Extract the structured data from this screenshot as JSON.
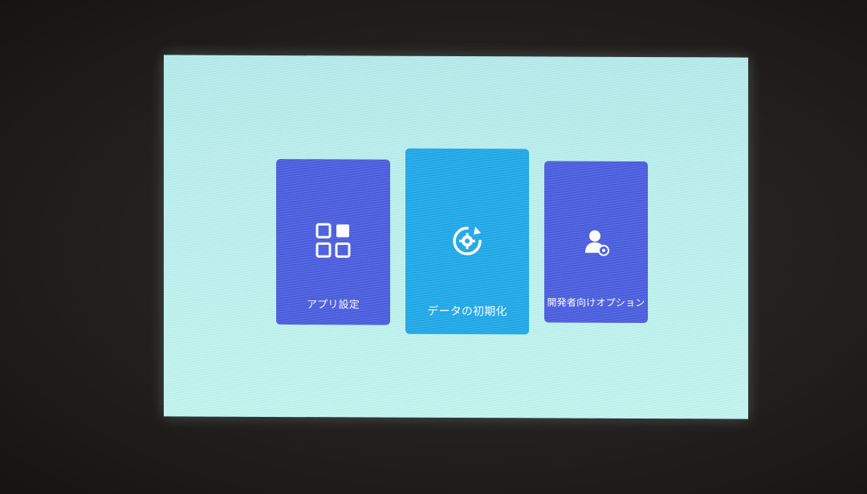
{
  "menu": {
    "items": [
      {
        "label": "アプリ設定",
        "icon": "apps-grid-icon"
      },
      {
        "label": "データの初期化",
        "icon": "factory-reset-icon"
      },
      {
        "label": "開発者向けオプション",
        "icon": "developer-user-icon"
      }
    ],
    "selected_index": 1
  },
  "colors": {
    "screen_background": "#bdf1ef",
    "card_default": "#4a5de0",
    "card_selected": "#1fa9ea",
    "text": "#ffffff"
  }
}
